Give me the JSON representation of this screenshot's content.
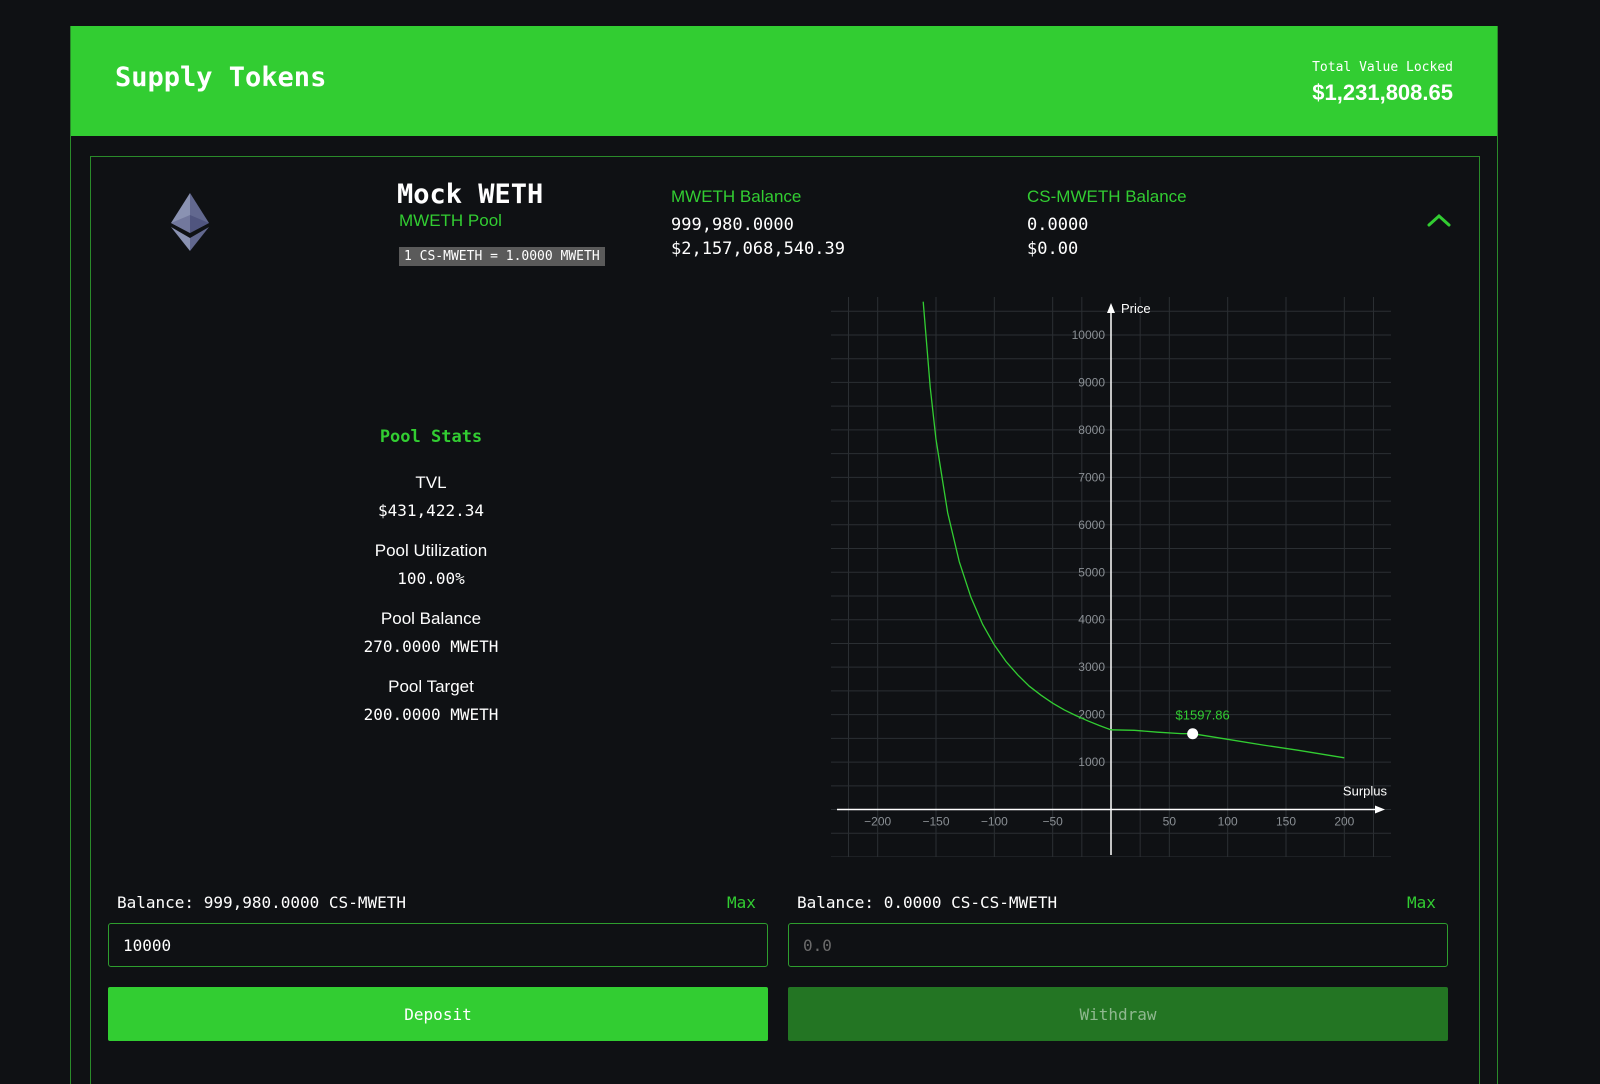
{
  "header": {
    "title": "Supply Tokens",
    "tvl_label": "Total Value Locked",
    "tvl_value": "$1,231,808.65"
  },
  "token": {
    "name": "Mock WETH",
    "pool": "MWETH Pool",
    "rate": "1 CS-MWETH = 1.0000 MWETH",
    "icon": "ethereum-icon"
  },
  "balances": {
    "mweth": {
      "label": "MWETH Balance",
      "amount": "999,980.0000",
      "usd": "$2,157,068,540.39"
    },
    "cs_mweth": {
      "label": "CS-MWETH Balance",
      "amount": "0.0000",
      "usd": "$0.00"
    }
  },
  "pool_stats": {
    "title": "Pool Stats",
    "items": [
      {
        "label": "TVL",
        "value": "$431,422.34"
      },
      {
        "label": "Pool Utilization",
        "value": "100.00%"
      },
      {
        "label": "Pool Balance",
        "value": "270.0000 MWETH"
      },
      {
        "label": "Pool Target",
        "value": "200.0000 MWETH"
      }
    ]
  },
  "chart_data": {
    "type": "line",
    "xlabel": "Surplus",
    "ylabel": "Price",
    "xlim": [
      -240,
      240
    ],
    "ylim": [
      -1000,
      10800
    ],
    "x_ticks": [
      -200,
      -150,
      -100,
      -50,
      50,
      100,
      150,
      200
    ],
    "x_tick_labels": [
      "−200",
      "−150",
      "−100",
      "−50",
      "50",
      "100",
      "150",
      "200"
    ],
    "y_ticks": [
      1000,
      2000,
      3000,
      4000,
      5000,
      6000,
      7000,
      8000,
      9000,
      10000
    ],
    "y_tick_labels": [
      "1000",
      "2000",
      "3000",
      "4000",
      "5000",
      "6000",
      "7000",
      "8000",
      "9000",
      "10000"
    ],
    "grid": true,
    "series": [
      {
        "x": [
          -161,
          -155,
          -150,
          -140,
          -130,
          -120,
          -110,
          -100,
          -90,
          -80,
          -70,
          -60,
          -50,
          -40,
          -30,
          -20,
          -10,
          0,
          20,
          40,
          60,
          70,
          100,
          130,
          160,
          200
        ],
        "y": [
          10700,
          8900,
          7800,
          6250,
          5220,
          4470,
          3900,
          3470,
          3120,
          2840,
          2600,
          2410,
          2240,
          2100,
          1980,
          1870,
          1770,
          1680,
          1670,
          1630,
          1600,
          1597.86,
          1480,
          1360,
          1250,
          1090
        ]
      }
    ],
    "marker": {
      "x": 70,
      "y": 1597.86,
      "label": "$1597.86"
    },
    "colors": {
      "line": "#32cd32",
      "grid": "#2b2f33",
      "axis": "#ffffff",
      "tick": "#8a8f94"
    }
  },
  "deposit": {
    "balance_label": "Balance: 999,980.0000 CS-MWETH",
    "max_label": "Max",
    "input_value": "10000",
    "button_label": "Deposit"
  },
  "withdraw": {
    "balance_label": "Balance: 0.0000 CS-CS-MWETH",
    "max_label": "Max",
    "input_placeholder": "0.0",
    "button_label": "Withdraw"
  }
}
